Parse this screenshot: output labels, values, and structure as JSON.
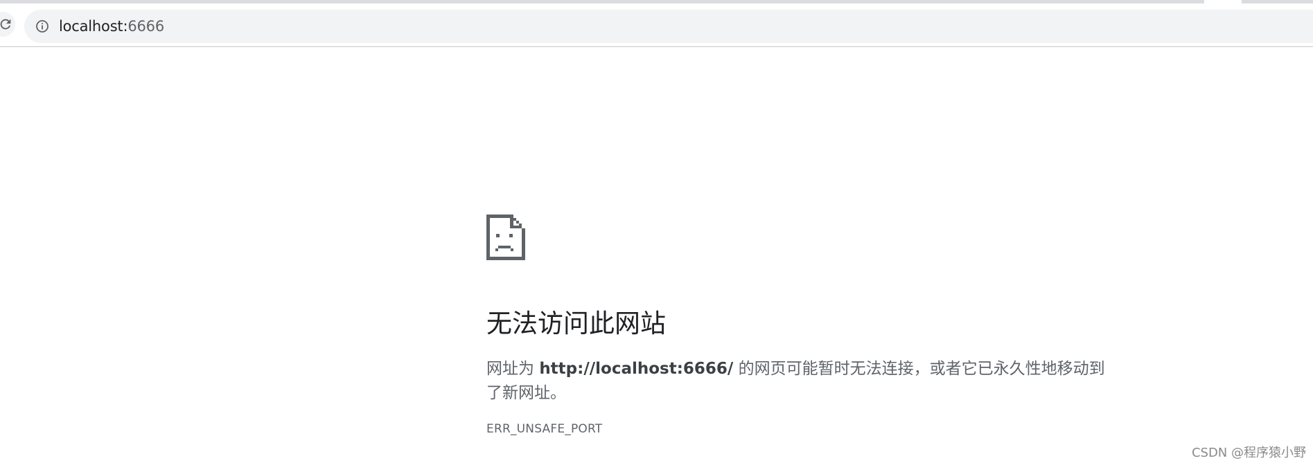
{
  "browser": {
    "omnibox": {
      "url_host": "localhost:",
      "url_port": "6666"
    },
    "icons": {
      "reload": "reload-icon",
      "info": "info-icon"
    }
  },
  "error_page": {
    "icon": "sad-document-icon",
    "title": "无法访问此网站",
    "description_prefix": "网址为 ",
    "description_url": "http://localhost:6666/",
    "description_suffix": " 的网页可能暂时无法连接，或者它已永久性地移动到了新网址。",
    "error_code": "ERR_UNSAFE_PORT"
  },
  "watermark": {
    "text": "CSDN @程序猿小野"
  },
  "colors": {
    "omnibox_bg": "#f1f3f4",
    "text_primary": "#202124",
    "text_secondary": "#5f6368",
    "icon": "#5f6368"
  }
}
